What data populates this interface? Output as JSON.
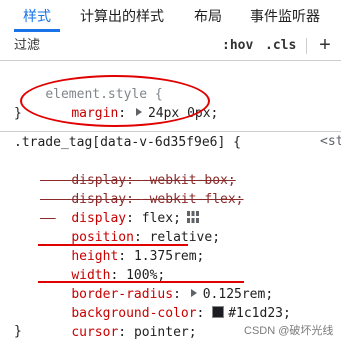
{
  "tabs": [
    {
      "label": "样式",
      "active": true
    },
    {
      "label": "计算出的样式",
      "active": false
    },
    {
      "label": "布局",
      "active": false
    },
    {
      "label": "事件监听器",
      "active": false
    }
  ],
  "filter": {
    "placeholder": "过滤",
    "hov": ":hov",
    "cls": ".cls",
    "plus": "+"
  },
  "element_style": {
    "selector": "element.style {",
    "decl": {
      "prop": "margin",
      "value": "24px 0px;"
    },
    "close": "}"
  },
  "trade_tag": {
    "selector": ".trade_tag[data-v-6d35f9e6] {",
    "source": "<st",
    "decls": [
      {
        "prop": "display",
        "value": "-webkit-box;",
        "struck": true
      },
      {
        "prop": "display",
        "value": "-webkit-flex;",
        "struck": true
      },
      {
        "prop": "display",
        "value": "flex;",
        "struck": false
      },
      {
        "prop": "position",
        "value": "relative;",
        "struck": false
      },
      {
        "prop": "height",
        "value": "1.375rem;",
        "struck": false
      },
      {
        "prop": "width",
        "value": "100%;",
        "struck": false
      },
      {
        "prop": "border-radius",
        "value": "0.125rem;",
        "struck": false
      },
      {
        "prop": "background-color",
        "value": "#1c1d23;",
        "struck": false
      },
      {
        "prop": "cursor",
        "value": "pointer;",
        "struck": false
      }
    ],
    "close": "}"
  },
  "colors": {
    "accent": "#1a73e8",
    "annotation": "#e00000",
    "bg_swatch": "#1c1d23"
  },
  "watermark": "CSDN @破坏光线"
}
